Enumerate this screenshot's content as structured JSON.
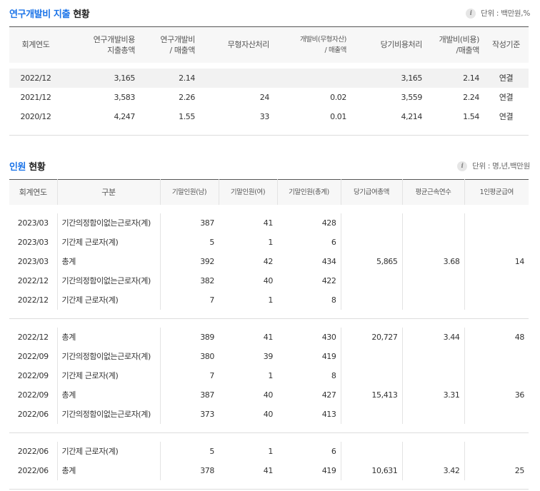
{
  "rd": {
    "title_highlight": "연구개발비 지출",
    "title_rest": "현황",
    "unit": "단위 : 백만원,%",
    "headers": [
      "회계연도",
      "연구개발비용\n지출총액",
      "연구개발비\n/ 매출액",
      "무형자산처리",
      "개발비(무형자산)\n/ 매출액",
      "당기비용처리",
      "개발비(비용)\n/매출액",
      "작성기준"
    ],
    "rows": [
      [
        "2022/12",
        "3,165",
        "2.14",
        "",
        "",
        "3,165",
        "2.14",
        "연결"
      ],
      [
        "2021/12",
        "3,583",
        "2.26",
        "24",
        "0.02",
        "3,559",
        "2.24",
        "연결"
      ],
      [
        "2020/12",
        "4,247",
        "1.55",
        "33",
        "0.01",
        "4,214",
        "1.54",
        "연결"
      ]
    ]
  },
  "hr": {
    "title_highlight": "인원",
    "title_rest": "현황",
    "unit": "단위 : 명,년,백만원",
    "headers": [
      "회계연도",
      "구분",
      "기말인원(남)",
      "기말인원(여)",
      "기말인원(총계)",
      "당기급여총액",
      "평균근속연수",
      "1인평균급여"
    ],
    "groups": [
      {
        "rows": [
          [
            "2023/03",
            "기간의정함이없는근로자(계)",
            "387",
            "41",
            "428"
          ],
          [
            "2023/03",
            "기간제 근로자(계)",
            "5",
            "1",
            "6"
          ],
          [
            "2023/03",
            "총계",
            "392",
            "42",
            "434"
          ],
          [
            "2022/12",
            "기간의정함이없는근로자(계)",
            "382",
            "40",
            "422"
          ],
          [
            "2022/12",
            "기간제 근로자(계)",
            "7",
            "1",
            "8"
          ]
        ],
        "summary": [
          {
            "row": 2,
            "salary_total": "5,865",
            "avg_years": "3.68",
            "avg_salary": "14"
          }
        ]
      },
      {
        "rows": [
          [
            "2022/12",
            "총계",
            "389",
            "41",
            "430"
          ],
          [
            "2022/09",
            "기간의정함이없는근로자(계)",
            "380",
            "39",
            "419"
          ],
          [
            "2022/09",
            "기간제 근로자(계)",
            "7",
            "1",
            "8"
          ],
          [
            "2022/09",
            "총계",
            "387",
            "40",
            "427"
          ],
          [
            "2022/06",
            "기간의정함이없는근로자(계)",
            "373",
            "40",
            "413"
          ]
        ],
        "summary": [
          {
            "row": 0,
            "salary_total": "20,727",
            "avg_years": "3.44",
            "avg_salary": "48"
          },
          {
            "row": 3,
            "salary_total": "15,413",
            "avg_years": "3.31",
            "avg_salary": "36"
          }
        ]
      },
      {
        "rows": [
          [
            "2022/06",
            "기간제 근로자(계)",
            "5",
            "1",
            "6"
          ],
          [
            "2022/06",
            "총계",
            "378",
            "41",
            "419"
          ]
        ],
        "summary": [
          {
            "row": 1,
            "salary_total": "10,631",
            "avg_years": "3.42",
            "avg_salary": "25"
          }
        ]
      }
    ]
  }
}
